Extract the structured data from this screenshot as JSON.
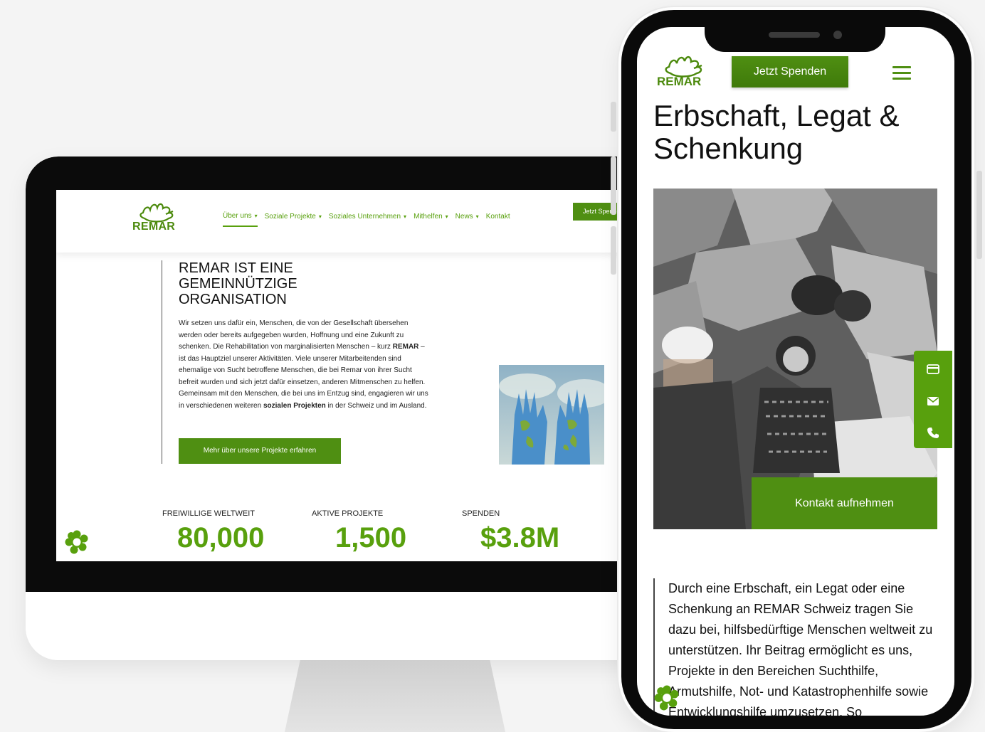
{
  "desktop": {
    "logo_text": "REMAR",
    "nav": [
      {
        "label": "Über uns",
        "has_dropdown": true,
        "active": true
      },
      {
        "label": "Soziale Projekte",
        "has_dropdown": true,
        "active": false
      },
      {
        "label": "Soziales Unternehmen",
        "has_dropdown": true,
        "active": false
      },
      {
        "label": "Mithelfen",
        "has_dropdown": true,
        "active": false
      },
      {
        "label": "News",
        "has_dropdown": true,
        "active": false
      },
      {
        "label": "Kontakt",
        "has_dropdown": false,
        "active": false
      }
    ],
    "cta_label": "Jetzt Spenden",
    "heading_bold": "REMAR",
    "heading_rest": " IST EINE GEMEINNÜTZIGE ORGANISATION",
    "body_parts": [
      "Wir setzen uns dafür ein, Menschen, die von der Gesellschaft übersehen werden oder bereits aufgegeben wurden, Hoffnung und eine Zukunft zu schenken. Die Rehabilitation von marginalisierten Menschen – kurz ",
      "REMAR",
      " – ist das Hauptziel unserer Aktivitäten. Viele unserer Mitarbeitenden sind ehemalige von Sucht betroffene Menschen, die bei Remar von ihrer Sucht befreit wurden und sich jetzt dafür einsetzen, anderen Mitmenschen zu helfen. Gemeinsam mit den Menschen, die bei uns im Entzug sind, engagieren wir uns in verschiedenen weiteren ",
      "sozialen Projekten",
      " in der Schweiz und im Ausland."
    ],
    "projects_button": "Mehr über unsere Projekte erfahren",
    "stats": [
      {
        "label": "FREIWILLIGE WELTWEIT",
        "value": "80,000"
      },
      {
        "label": "AKTIVE PROJEKTE",
        "value": "1,500"
      },
      {
        "label": "SPENDEN",
        "value": "$3.8M"
      }
    ]
  },
  "mobile": {
    "logo_text": "REMAR",
    "cta_label": "Jetzt Spenden",
    "title": "Erbschaft, Legat & Schenkung",
    "contact_button": "Kontakt aufnehmen",
    "side_icons": [
      "credit-card-icon",
      "mail-icon",
      "phone-icon"
    ],
    "body": "Durch eine Erbschaft, ein Legat oder eine Schenkung an REMAR Schweiz tragen Sie dazu bei, hilfsbedürftige Menschen weltweit zu unterstützen. Ihr Beitrag ermöglicht es uns, Projekte in den Bereichen Suchthilfe, Armutshilfe, Not- und Katastrophenhilfe sowie Entwicklungshilfe umzusetzen. So"
  },
  "colors": {
    "brand_green": "#58a00d",
    "button_green": "#4f8f12",
    "logo_green": "#4c8a0d"
  }
}
